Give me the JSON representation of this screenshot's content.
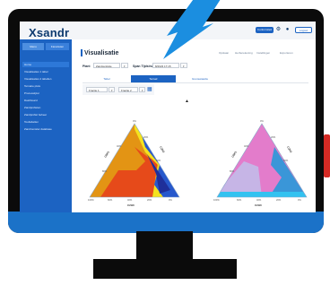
{
  "app": {
    "logo": "Xsandr",
    "top_buttons": [
      "Conformiteit",
      "Help",
      "Account",
      "Logout"
    ]
  },
  "sidebar": {
    "tabs": [
      "Menu",
      "Favorieten"
    ],
    "items": [
      {
        "label": "Home",
        "active": true
      },
      {
        "label": "Visualisaties 1 tabel"
      },
      {
        "label": "Visualisaties 2 tabellen"
      },
      {
        "label": "Ternaire plots"
      },
      {
        "label": "Proceswijzer"
      },
      {
        "label": "Dashboard"
      },
      {
        "label": "Zandprofielen"
      },
      {
        "label": "Zandprofiel beheer"
      },
      {
        "label": "Tooltabellen"
      },
      {
        "label": "Zandmonster database"
      }
    ]
  },
  "main": {
    "title": "Visualisatie",
    "tools": [
      "Opslaan",
      "Herberekening",
      "Instellingen",
      "Exporteren"
    ],
    "field1_label": "Plant",
    "field1_value": "Zandcentrale",
    "field2_label": "Span Tijdsinv.",
    "field2_value": "8/2023 17:15",
    "tabs": [
      {
        "label": "Tabel",
        "active": false
      },
      {
        "label": "Ternair",
        "active": true
      },
      {
        "label": "Grenswaarde",
        "active": false
      }
    ],
    "filter1": "Fractie 1",
    "filter2": "Fractie 2"
  },
  "chart_data": [
    {
      "type": "ternary",
      "axes": {
        "left": "C0H1",
        "right": "C2H3",
        "bottom": "C2H0"
      },
      "ticks": [
        "100%",
        "80%",
        "60%",
        "40%",
        "20%",
        "0%"
      ],
      "regions": [
        "orange",
        "red",
        "yellow",
        "navy",
        "blue"
      ],
      "colors": {
        "orange": "#e39414",
        "red": "#e64a1a",
        "yellow": "#f4e21f",
        "navy": "#1f2f9a",
        "blue": "#2758cc"
      }
    },
    {
      "type": "ternary",
      "axes": {
        "left": "C0H1",
        "right": "C2H3",
        "bottom": "C2H0"
      },
      "ticks": [
        "100%",
        "80%",
        "60%",
        "40%",
        "20%",
        "0%"
      ],
      "regions": [
        "pink",
        "lavender",
        "teal",
        "cyan"
      ],
      "colors": {
        "pink": "#e37ccb",
        "lavender": "#c6b5e6",
        "teal": "#3a96d8",
        "cyan": "#33c2f0"
      }
    }
  ]
}
